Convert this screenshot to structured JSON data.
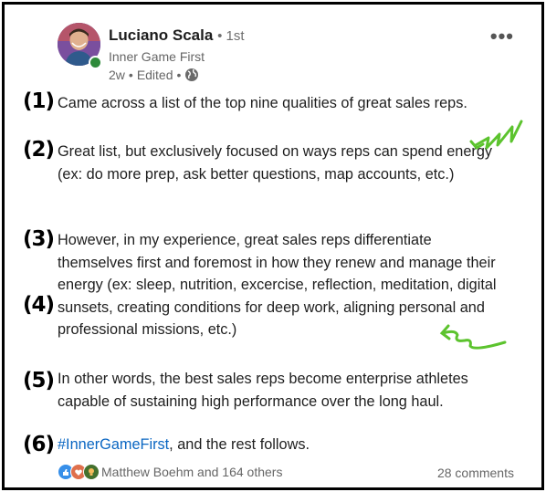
{
  "post": {
    "author": {
      "name": "Luciano Scala",
      "degree": "1st",
      "company": "Inner Game First",
      "age": "2w",
      "edited": "Edited"
    },
    "paragraphs": [
      {
        "marker": "(1)",
        "text": "Came across a list of the top nine qualities of great sales reps."
      },
      {
        "marker": "(2)",
        "text": "Great list, but exclusively focused on ways reps can spend energy (ex: do more prep, ask better questions, map accounts, etc.)"
      },
      {
        "marker": "(3)",
        "text": "However, in my experience, great sales reps differentiate themselves first and foremost in how they renew and manage their energy (ex: sleep, nutrition, excercise, reflection, meditation, digital sunsets, creating conditions for deep work, aligning personal and professional missions, etc.)"
      },
      {
        "marker": "(4)",
        "text": ""
      },
      {
        "marker": "(5)",
        "text": "In other words, the best sales reps become enterprise athletes capable of sustaining high performance over the long haul."
      },
      {
        "marker": "(6)",
        "hashtag": "#InnerGameFirst",
        "text": ", and the rest follows."
      }
    ],
    "footer": {
      "reactions_label": "Matthew Boehm and 164 others",
      "comments_label": "28 comments"
    },
    "colors": {
      "hashtag": "#0a66c2",
      "squiggle": "#5cc32e"
    },
    "icons": [
      "globe-icon",
      "more-options-icon",
      "like-reaction-icon",
      "love-reaction-icon",
      "insightful-reaction-icon"
    ]
  }
}
